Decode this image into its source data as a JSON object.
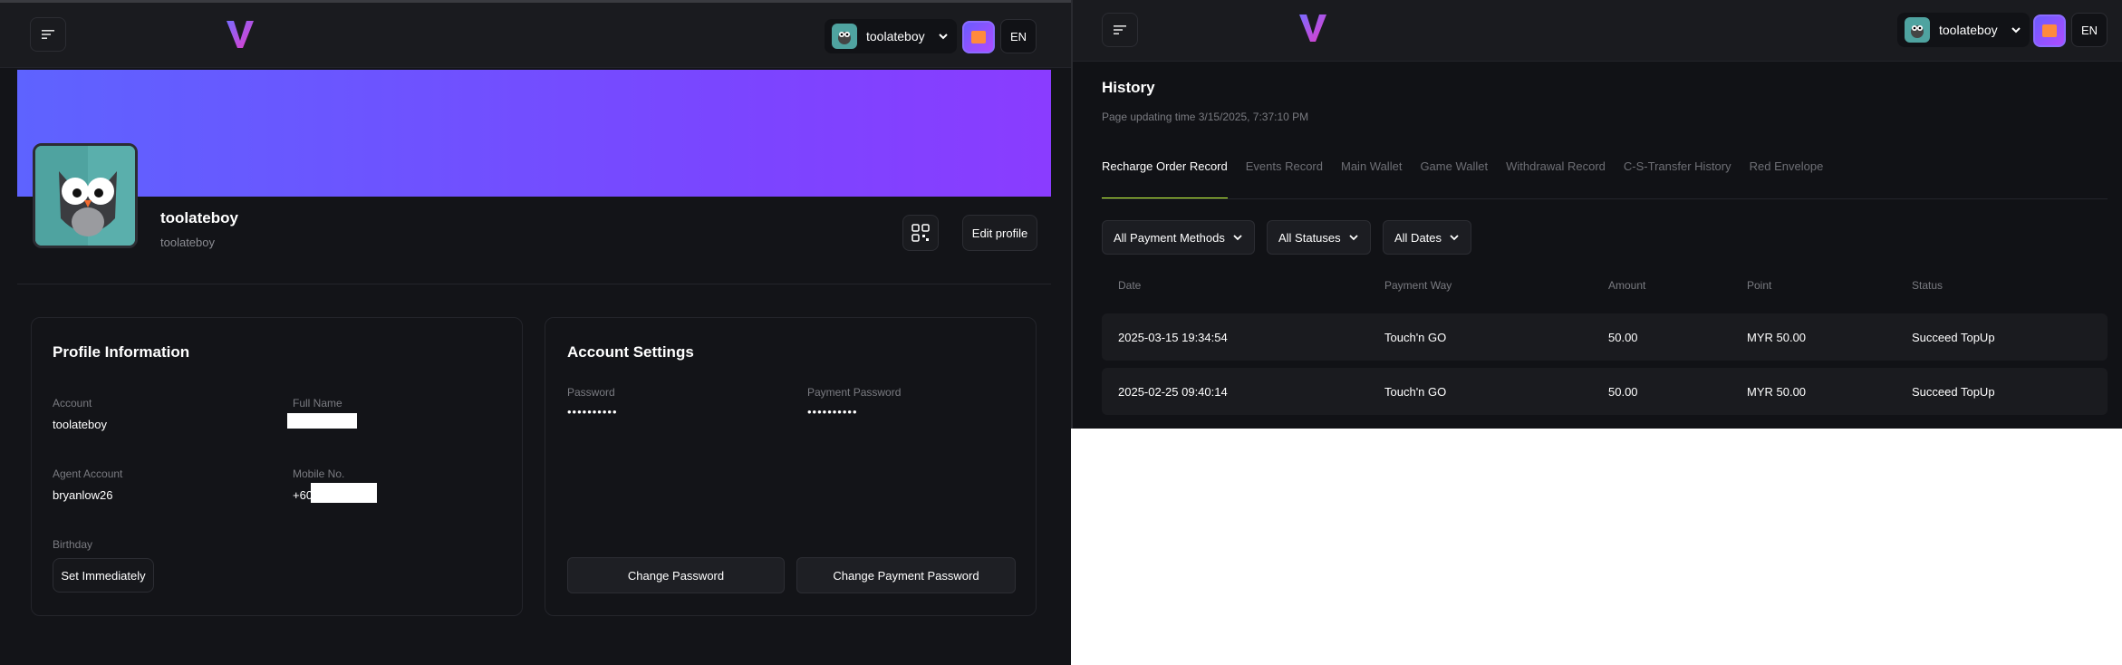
{
  "header": {
    "username": "toolateboy",
    "language": "EN"
  },
  "profile": {
    "name": "toolateboy",
    "username": "toolateboy",
    "edit_label": "Edit profile"
  },
  "profile_info": {
    "title": "Profile Information",
    "account_label": "Account",
    "account_value": "toolateboy",
    "fullname_label": "Full Name",
    "fullname_value": "",
    "agent_label": "Agent Account",
    "agent_value": "bryanlow26",
    "mobile_label": "Mobile No.",
    "mobile_prefix": "+60",
    "birthday_label": "Birthday",
    "birthday_button": "Set Immediately"
  },
  "account_settings": {
    "title": "Account Settings",
    "password_label": "Password",
    "password_value": "••••••••••",
    "payment_password_label": "Payment Password",
    "payment_password_value": "••••••••••",
    "change_password": "Change Password",
    "change_payment_password": "Change Payment Password"
  },
  "history": {
    "title": "History",
    "updating": "Page updating time 3/15/2025, 7:37:10 PM",
    "tabs": [
      {
        "label": "Recharge Order Record"
      },
      {
        "label": "Events Record"
      },
      {
        "label": "Main Wallet"
      },
      {
        "label": "Game Wallet"
      },
      {
        "label": "Withdrawal Record"
      },
      {
        "label": "C-S-Transfer History"
      },
      {
        "label": "Red Envelope"
      }
    ],
    "filters": [
      "All Payment Methods",
      "All Statuses",
      "All Dates"
    ],
    "columns": [
      "Date",
      "Payment Way",
      "Amount",
      "Point",
      "Status"
    ],
    "rows": [
      [
        "2025-03-15 19:34:54",
        "Touch'n GO",
        "50.00",
        "MYR 50.00",
        "Succeed TopUp"
      ],
      [
        "2025-02-25 09:40:14",
        "Touch'n GO",
        "50.00",
        "MYR 50.00",
        "Succeed TopUp"
      ]
    ]
  }
}
